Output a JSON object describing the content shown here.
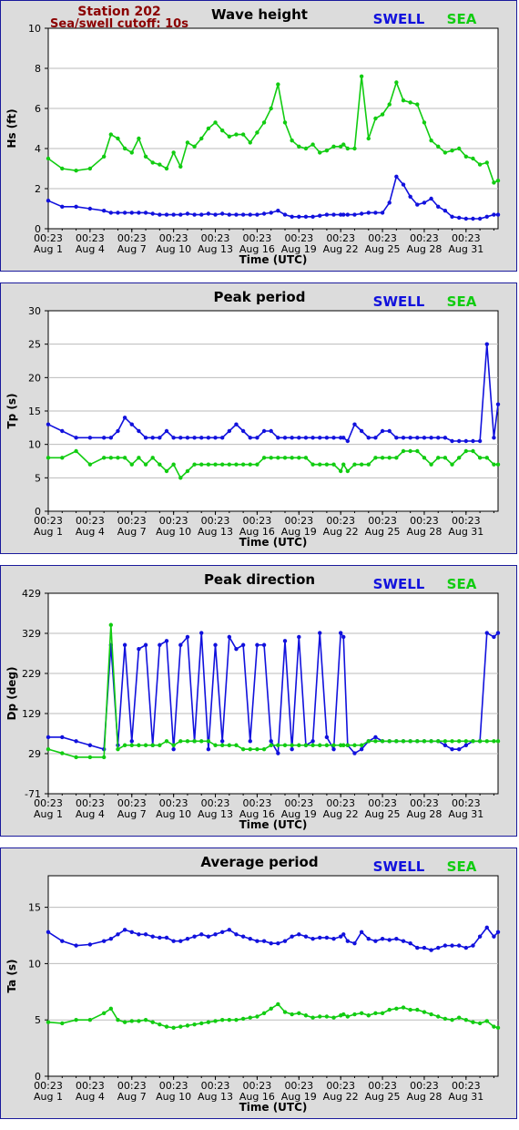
{
  "header": {
    "station": "Station 202",
    "cutoff": "Sea/swell cutoff: 10s"
  },
  "legend": {
    "swell": "SWELL",
    "sea": "SEA"
  },
  "colors": {
    "swell": "#1111dd",
    "sea": "#11cc11",
    "station": "#8b0000",
    "panel_bg": "#dcdcdc",
    "border": "#1a1a9c"
  },
  "x_axis": {
    "label": "Time (UTC)",
    "time_label": "00:23",
    "dates": [
      "Aug 1",
      "Aug 4",
      "Aug 7",
      "Aug 10",
      "Aug 13",
      "Aug 16",
      "Aug 19",
      "Aug 22",
      "Aug 25",
      "Aug 28",
      "Aug 31"
    ],
    "day_range": [
      0,
      32.3
    ]
  },
  "chart_data": [
    {
      "type": "line",
      "title": "Wave height",
      "xlabel": "Time (UTC)",
      "ylabel": "Hs (ft)",
      "ylim": [
        0,
        10
      ],
      "yticks": [
        "0",
        "2",
        "4",
        "6",
        "8",
        "10"
      ],
      "grid": true,
      "x_days": [
        0,
        1,
        2,
        3,
        4,
        4.5,
        5,
        5.5,
        6,
        6.5,
        7,
        7.5,
        8,
        8.5,
        9,
        9.5,
        10,
        10.5,
        11,
        11.5,
        12,
        12.5,
        13,
        13.5,
        14,
        14.5,
        15,
        15.5,
        16,
        16.5,
        17,
        17.5,
        18,
        18.5,
        19,
        19.5,
        20,
        20.5,
        21,
        21.2,
        21.5,
        22,
        22.5,
        23,
        23.5,
        24,
        24.5,
        25,
        25.5,
        26,
        26.5,
        27,
        27.5,
        28,
        28.5,
        29,
        29.5,
        30,
        30.5,
        31,
        31.5,
        32,
        32.3
      ],
      "series": [
        {
          "name": "SWELL",
          "values": [
            1.4,
            1.1,
            1.1,
            1.0,
            0.9,
            0.8,
            0.8,
            0.8,
            0.8,
            0.8,
            0.8,
            0.75,
            0.7,
            0.7,
            0.7,
            0.7,
            0.75,
            0.7,
            0.7,
            0.75,
            0.7,
            0.75,
            0.7,
            0.7,
            0.7,
            0.7,
            0.7,
            0.75,
            0.8,
            0.9,
            0.7,
            0.6,
            0.6,
            0.6,
            0.6,
            0.65,
            0.7,
            0.7,
            0.7,
            0.7,
            0.7,
            0.7,
            0.75,
            0.8,
            0.8,
            0.8,
            1.3,
            2.6,
            2.2,
            1.6,
            1.2,
            1.3,
            1.5,
            1.1,
            0.9,
            0.6,
            0.55,
            0.5,
            0.5,
            0.5,
            0.6,
            0.7,
            0.7
          ]
        },
        {
          "name": "SEA",
          "values": [
            3.5,
            3.0,
            2.9,
            3.0,
            3.6,
            4.7,
            4.5,
            4.0,
            3.8,
            4.5,
            3.6,
            3.3,
            3.2,
            3.0,
            3.8,
            3.1,
            4.3,
            4.1,
            4.5,
            5.0,
            5.3,
            4.9,
            4.6,
            4.7,
            4.7,
            4.3,
            4.8,
            5.3,
            6.0,
            7.2,
            5.3,
            4.4,
            4.1,
            4.0,
            4.2,
            3.8,
            3.9,
            4.1,
            4.1,
            4.2,
            4.0,
            4.0,
            7.6,
            4.5,
            5.5,
            5.7,
            6.2,
            7.3,
            6.4,
            6.3,
            6.2,
            5.3,
            4.4,
            4.1,
            3.8,
            3.9,
            4.0,
            3.6,
            3.5,
            3.2,
            3.3,
            2.3,
            2.4
          ]
        }
      ]
    },
    {
      "type": "line",
      "title": "Peak period",
      "xlabel": "Time (UTC)",
      "ylabel": "Tp (s)",
      "ylim": [
        0,
        30
      ],
      "yticks": [
        "0",
        "5",
        "10",
        "15",
        "20",
        "25",
        "30"
      ],
      "grid": true,
      "x_days": [
        0,
        1,
        2,
        3,
        4,
        4.5,
        5,
        5.5,
        6,
        6.5,
        7,
        7.5,
        8,
        8.5,
        9,
        9.5,
        10,
        10.5,
        11,
        11.5,
        12,
        12.5,
        13,
        13.5,
        14,
        14.5,
        15,
        15.5,
        16,
        16.5,
        17,
        17.5,
        18,
        18.5,
        19,
        19.5,
        20,
        20.5,
        21,
        21.2,
        21.5,
        22,
        22.5,
        23,
        23.5,
        24,
        24.5,
        25,
        25.5,
        26,
        26.5,
        27,
        27.5,
        28,
        28.5,
        29,
        29.5,
        30,
        30.5,
        31,
        31.5,
        32,
        32.3
      ],
      "series": [
        {
          "name": "SWELL",
          "values": [
            13,
            12,
            11,
            11,
            11,
            11,
            12,
            14,
            13,
            12,
            11,
            11,
            11,
            12,
            11,
            11,
            11,
            11,
            11,
            11,
            11,
            11,
            12,
            13,
            12,
            11,
            11,
            12,
            12,
            11,
            11,
            11,
            11,
            11,
            11,
            11,
            11,
            11,
            11,
            11,
            10.5,
            13,
            12,
            11,
            11,
            12,
            12,
            11,
            11,
            11,
            11,
            11,
            11,
            11,
            11,
            10.5,
            10.5,
            10.5,
            10.5,
            10.5,
            25,
            11,
            16
          ]
        },
        {
          "name": "SEA",
          "values": [
            8,
            8,
            9,
            7,
            8,
            8,
            8,
            8,
            7,
            8,
            7,
            8,
            7,
            6,
            7,
            5,
            6,
            7,
            7,
            7,
            7,
            7,
            7,
            7,
            7,
            7,
            7,
            8,
            8,
            8,
            8,
            8,
            8,
            8,
            7,
            7,
            7,
            7,
            6,
            7,
            6,
            7,
            7,
            7,
            8,
            8,
            8,
            8,
            9,
            9,
            9,
            8,
            7,
            8,
            8,
            7,
            8,
            9,
            9,
            8,
            8,
            7,
            7
          ]
        }
      ]
    },
    {
      "type": "line",
      "title": "Peak direction",
      "xlabel": "Time (UTC)",
      "ylabel": "Dp (deg)",
      "ylim": [
        -71,
        429
      ],
      "yticks": [
        "-71",
        "29",
        "129",
        "229",
        "329",
        "429"
      ],
      "grid": true,
      "x_days": [
        0,
        1,
        2,
        3,
        4,
        4.5,
        5,
        5.5,
        6,
        6.5,
        7,
        7.5,
        8,
        8.5,
        9,
        9.5,
        10,
        10.5,
        11,
        11.5,
        12,
        12.5,
        13,
        13.5,
        14,
        14.5,
        15,
        15.5,
        16,
        16.5,
        17,
        17.5,
        18,
        18.5,
        19,
        19.5,
        20,
        20.5,
        21,
        21.2,
        21.5,
        22,
        22.5,
        23,
        23.5,
        24,
        24.5,
        25,
        25.5,
        26,
        26.5,
        27,
        27.5,
        28,
        28.5,
        29,
        29.5,
        30,
        30.5,
        31,
        31.5,
        32,
        32.3
      ],
      "series": [
        {
          "name": "SWELL",
          "values": [
            70,
            70,
            60,
            50,
            40,
            300,
            50,
            300,
            60,
            290,
            300,
            50,
            300,
            310,
            40,
            300,
            320,
            60,
            330,
            40,
            300,
            60,
            320,
            290,
            300,
            60,
            300,
            300,
            60,
            30,
            310,
            40,
            320,
            50,
            60,
            330,
            70,
            40,
            330,
            320,
            50,
            30,
            40,
            60,
            70,
            60,
            60,
            60,
            60,
            60,
            60,
            60,
            60,
            60,
            50,
            40,
            40,
            50,
            60,
            60,
            330,
            320,
            330
          ]
        },
        {
          "name": "SEA",
          "values": [
            40,
            30,
            20,
            20,
            20,
            350,
            40,
            50,
            50,
            50,
            50,
            50,
            50,
            60,
            50,
            60,
            60,
            60,
            60,
            60,
            50,
            50,
            50,
            50,
            40,
            40,
            40,
            40,
            50,
            50,
            50,
            50,
            50,
            50,
            50,
            50,
            50,
            50,
            50,
            50,
            50,
            50,
            50,
            60,
            60,
            60,
            60,
            60,
            60,
            60,
            60,
            60,
            60,
            60,
            60,
            60,
            60,
            60,
            60,
            60,
            60,
            60,
            60
          ]
        }
      ]
    },
    {
      "type": "line",
      "title": "Average period",
      "xlabel": "Time (UTC)",
      "ylabel": "Ta (s)",
      "ylim": [
        0,
        17.8
      ],
      "yticks": [
        "0",
        "5",
        "10",
        "15"
      ],
      "grid": true,
      "x_days": [
        0,
        1,
        2,
        3,
        4,
        4.5,
        5,
        5.5,
        6,
        6.5,
        7,
        7.5,
        8,
        8.5,
        9,
        9.5,
        10,
        10.5,
        11,
        11.5,
        12,
        12.5,
        13,
        13.5,
        14,
        14.5,
        15,
        15.5,
        16,
        16.5,
        17,
        17.5,
        18,
        18.5,
        19,
        19.5,
        20,
        20.5,
        21,
        21.2,
        21.5,
        22,
        22.5,
        23,
        23.5,
        24,
        24.5,
        25,
        25.5,
        26,
        26.5,
        27,
        27.5,
        28,
        28.5,
        29,
        29.5,
        30,
        30.5,
        31,
        31.5,
        32,
        32.3
      ],
      "series": [
        {
          "name": "SWELL",
          "values": [
            12.8,
            12.0,
            11.6,
            11.7,
            12.0,
            12.2,
            12.6,
            13.0,
            12.8,
            12.6,
            12.6,
            12.4,
            12.3,
            12.3,
            12.0,
            12.0,
            12.2,
            12.4,
            12.6,
            12.4,
            12.6,
            12.8,
            13.0,
            12.6,
            12.4,
            12.2,
            12.0,
            12.0,
            11.8,
            11.8,
            12.0,
            12.4,
            12.6,
            12.4,
            12.2,
            12.3,
            12.3,
            12.2,
            12.4,
            12.6,
            12.0,
            11.8,
            12.8,
            12.2,
            12.0,
            12.2,
            12.1,
            12.2,
            12.0,
            11.8,
            11.4,
            11.4,
            11.2,
            11.4,
            11.6,
            11.6,
            11.6,
            11.4,
            11.6,
            12.4,
            13.2,
            12.4,
            12.8
          ]
        },
        {
          "name": "SEA",
          "values": [
            4.8,
            4.7,
            5.0,
            5.0,
            5.6,
            6.0,
            5.0,
            4.8,
            4.9,
            4.9,
            5.0,
            4.8,
            4.6,
            4.4,
            4.3,
            4.4,
            4.5,
            4.6,
            4.7,
            4.8,
            4.9,
            5.0,
            5.0,
            5.0,
            5.1,
            5.2,
            5.3,
            5.6,
            6.0,
            6.4,
            5.7,
            5.5,
            5.6,
            5.4,
            5.2,
            5.3,
            5.3,
            5.2,
            5.4,
            5.5,
            5.3,
            5.5,
            5.6,
            5.4,
            5.6,
            5.6,
            5.9,
            6.0,
            6.1,
            5.9,
            5.9,
            5.7,
            5.5,
            5.3,
            5.1,
            5.0,
            5.2,
            5.0,
            4.8,
            4.7,
            4.9,
            4.4,
            4.3
          ]
        }
      ]
    }
  ]
}
